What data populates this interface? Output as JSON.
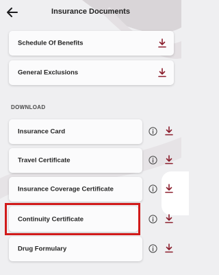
{
  "header": {
    "title": "Insurance Documents",
    "back_icon": "arrow-left-icon"
  },
  "top_documents": [
    {
      "label": "Schedule Of Benefits",
      "action_icon": "download-icon"
    },
    {
      "label": "General Exclusions",
      "action_icon": "download-icon"
    }
  ],
  "download_section": {
    "heading": "DOWNLOAD",
    "items": [
      {
        "label": "Insurance Card",
        "info_icon": "info-icon",
        "action_icon": "download-icon"
      },
      {
        "label": "Travel Certificate",
        "info_icon": "info-icon",
        "action_icon": "download-icon"
      },
      {
        "label": "Insurance Coverage Certificate",
        "info_icon": "info-icon",
        "action_icon": "download-icon"
      },
      {
        "label": "Continuity Certificate",
        "info_icon": "info-icon",
        "action_icon": "download-icon",
        "highlighted": true
      },
      {
        "label": "Drug Formulary",
        "info_icon": "info-icon",
        "action_icon": "download-icon"
      }
    ]
  },
  "colors": {
    "accent": "#8a1c2b",
    "highlight_border": "#d11a1a",
    "background": "#efeff1",
    "card": "#fbfbfc"
  }
}
